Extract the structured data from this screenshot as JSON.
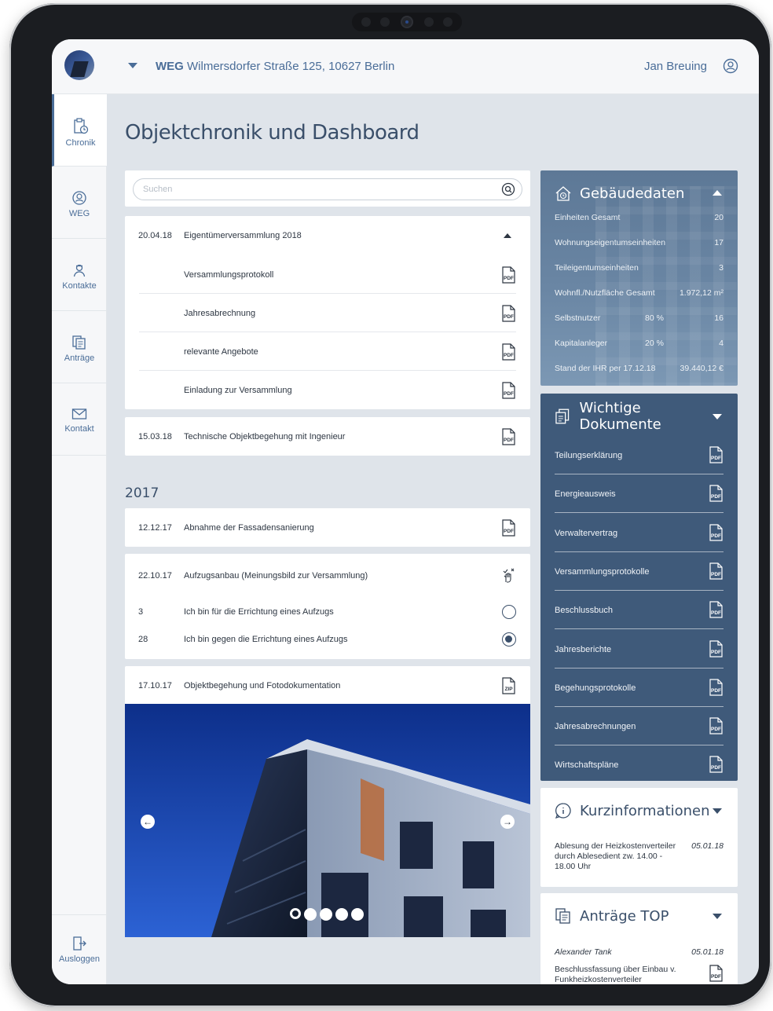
{
  "header": {
    "weg_label": "WEG",
    "address": "Wilmersdorfer Straße 125, 10627 Berlin",
    "user_name": "Jan Breuing"
  },
  "sidebar": {
    "items": [
      {
        "label": "Chronik",
        "icon": "chronik-icon",
        "active": true
      },
      {
        "label": "WEG",
        "icon": "weg-icon"
      },
      {
        "label": "Kontakte",
        "icon": "kontakte-icon"
      },
      {
        "label": "Anträge",
        "icon": "antraege-icon"
      },
      {
        "label": "Kontakt",
        "icon": "mail-icon"
      }
    ],
    "logout": "Ausloggen"
  },
  "main": {
    "title": "Objektchronik und Dashboard",
    "search_placeholder": "Suchen",
    "entries": [
      {
        "date": "20.04.18",
        "title": "Eigentümerversammlung 2018",
        "expanded": true,
        "documents": [
          "Versammlungsprotokoll",
          "Jahresabrechnung",
          "relevante Angebote",
          "Einladung zur Versammlung"
        ]
      },
      {
        "date": "15.03.18",
        "title": "Technische Objektbegehung mit Ingenieur",
        "file": "PDF"
      }
    ],
    "year": "2017",
    "entries_2017": [
      {
        "date": "12.12.17",
        "title": "Abnahme der Fassadensanierung",
        "file": "PDF"
      },
      {
        "date": "22.10.17",
        "title": "Aufzugsanbau (Meinungsbild zur Versammlung)",
        "poll": [
          {
            "count": "3",
            "option": "Ich bin für die Errichtung eines Aufzugs",
            "selected": false
          },
          {
            "count": "28",
            "option": "Ich bin gegen die Errichtung eines Aufzugs",
            "selected": true
          }
        ]
      },
      {
        "date": "17.10.17",
        "title": "Objektbegehung und Fotodokumentation",
        "file": "ZIP"
      }
    ],
    "gallery": {
      "slides": 5,
      "current": 1
    }
  },
  "gebaeudedaten": {
    "title": "Gebäudedaten",
    "rows": [
      {
        "label": "Einheiten Gesamt",
        "percent": "",
        "value": "20"
      },
      {
        "label": "Wohnungseigentumseinheiten",
        "percent": "",
        "value": "17"
      },
      {
        "label": "Teileigentumseinheiten",
        "percent": "",
        "value": "3"
      },
      {
        "label": "Wohnfl./Nutzfläche Gesamt",
        "percent": "",
        "value": "1.972,12 m²"
      },
      {
        "label": "Selbstnutzer",
        "percent": "80 %",
        "value": "16"
      },
      {
        "label": "Kapitalanleger",
        "percent": "20 %",
        "value": "4"
      },
      {
        "label": "Stand der IHR per 17.12.18",
        "percent": "",
        "value": "39.440,12 €"
      }
    ]
  },
  "dokumente": {
    "title": "Wichtige Dokumente",
    "items": [
      "Teilungserklärung",
      "Energieausweis",
      "Verwaltervertrag",
      "Versammlungsprotokolle",
      "Beschlussbuch",
      "Jahresberichte",
      "Begehungsprotokolle",
      "Jahresabrechnungen",
      "Wirtschaftspläne"
    ]
  },
  "kurzinfo": {
    "title": "Kurzinformationen",
    "text": "Ablesung der Heizkostenverteiler durch Ablesedient zw. 14.00 - 18.00 Uhr",
    "date": "05.01.18"
  },
  "antraege_top": {
    "title": "Anträge TOP",
    "author": "Alexander Tank",
    "date": "05.01.18",
    "text": "Beschlussfassung über Einbau v. Funkheizkostenverteiler"
  },
  "colors": {
    "accent": "#4a6d98",
    "panel_dark": "#3f5a7a",
    "background": "#dfe4ea"
  }
}
